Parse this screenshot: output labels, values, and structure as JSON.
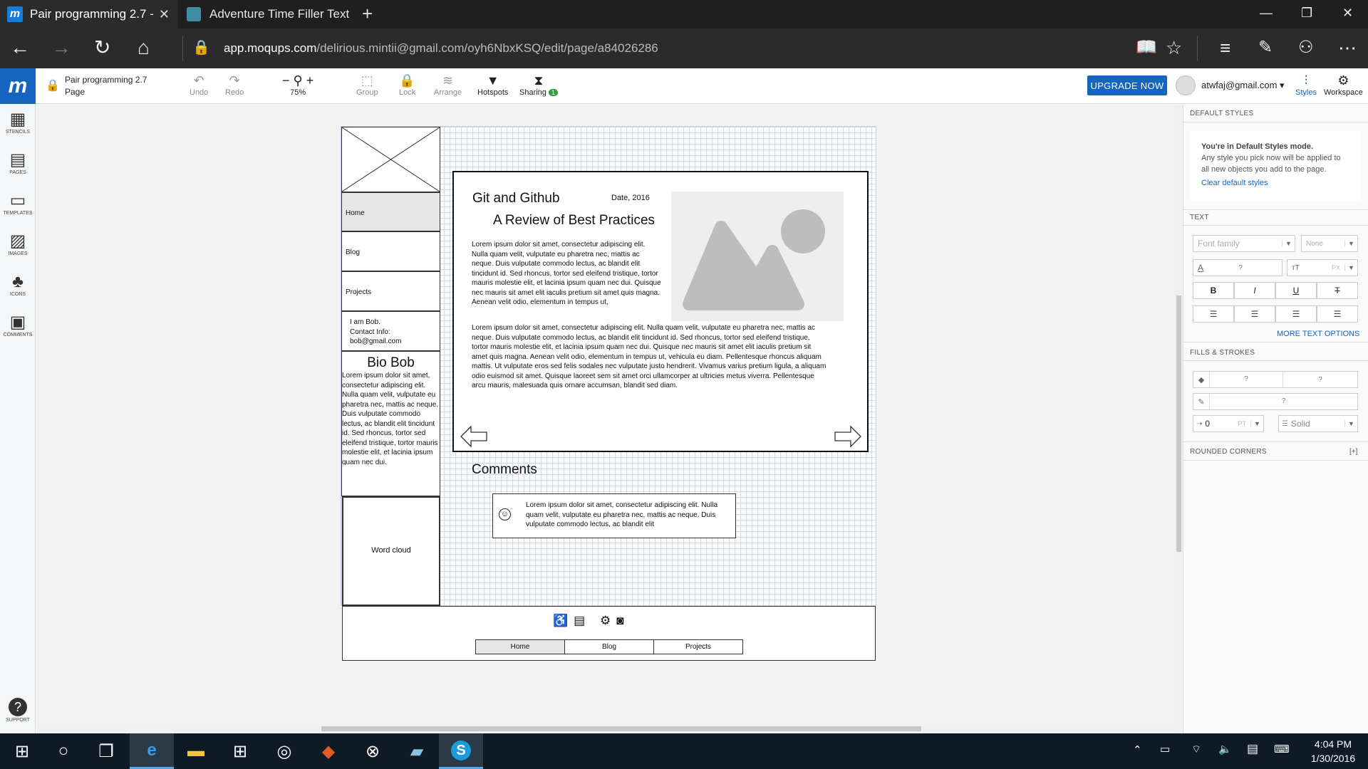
{
  "browser": {
    "tabs": [
      {
        "label": "Pair programming 2.7 -",
        "active": true
      },
      {
        "label": "Adventure Time Filler Text",
        "active": false
      }
    ],
    "url_domain": "app.moqups.com",
    "url_path": "/delirious.mintii@gmail.com/oyh6NbxKSQ/edit/page/a84026286"
  },
  "app": {
    "project": "Pair programming 2.7",
    "page_label": "Page",
    "toolbar": {
      "undo": "Undo",
      "redo": "Redo",
      "zoom": "75%",
      "group": "Group",
      "lock": "Lock",
      "arrange": "Arrange",
      "hotspots": "Hotspots",
      "sharing": "Sharing",
      "sharing_count": "1",
      "upgrade": "UPGRADE NOW",
      "user": "atwfaj@gmail.com",
      "styles": "Styles",
      "workspace": "Workspace"
    },
    "rail": [
      {
        "label": "STENCILS",
        "icon": "stencils-icon"
      },
      {
        "label": "PAGES",
        "icon": "pages-icon"
      },
      {
        "label": "TEMPLATES",
        "icon": "templates-icon"
      },
      {
        "label": "IMAGES",
        "icon": "images-icon"
      },
      {
        "label": "ICONS",
        "icon": "club-icon"
      },
      {
        "label": "COMMENTS",
        "icon": "comments-icon"
      },
      {
        "label": "SUPPORT",
        "icon": "help-icon"
      }
    ]
  },
  "mockup": {
    "nav": [
      "Home",
      "Blog",
      "Projects"
    ],
    "contact": [
      "I am Bob.",
      "Contact Info:",
      "bob@gmail.com"
    ],
    "bio_title": "Bio Bob",
    "bio_text": "Lorem ipsum dolor sit amet, consectetur adipiscing elit. Nulla quam velit, vulputate eu pharetra nec, mattis ac neque. Duis vulputate commodo lectus, ac blandit elit tincidunt id. Sed rhoncus, tortor sed eleifend tristique, tortor mauris molestie elit, et lacinia ipsum quam nec dui.",
    "word_cloud": "Word cloud",
    "post_title": "Git and Github",
    "post_date": "Date, 2016",
    "post_subtitle": "A Review of Best Practices",
    "post_para1": "Lorem ipsum dolor sit amet, consectetur adipiscing elit. Nulla quam velit, vulputate eu pharetra nec, mattis ac neque. Duis vulputate commodo lectus, ac blandit elit tincidunt id. Sed rhoncus, tortor sed eleifend tristique, tortor mauris molestie elit, et lacinia ipsum quam nec dui. Quisque nec mauris sit amet elit iaculis pretium sit amet quis magna. Aenean velit odio, elementum in tempus ut,",
    "post_para2": "Lorem ipsum dolor sit amet, consectetur adipiscing elit. Nulla quam velit, vulputate eu pharetra nec, mattis ac neque. Duis vulputate commodo lectus, ac blandit elit tincidunt id. Sed rhoncus, tortor sed eleifend tristique, tortor mauris molestie elit, et lacinia ipsum quam nec dui. Quisque nec mauris sit amet elit iaculis pretium sit amet quis magna. Aenean velit odio, elementum in tempus ut, vehicula eu diam. Pellentesque rhoncus aliquam mattis. Ut vulputate eros sed felis sodales nec vulputate justo hendrerit. Vivamus varius pretium ligula, a aliquam odio euismod sit amet. Quisque laoreet sem sit amet orci ullamcorper at ultricies metus viverra. Pellentesque arcu mauris, malesuada quis ornare accumsan, blandit sed diam.",
    "comments_title": "Comments",
    "comment_text": "Lorem ipsum dolor sit amet, consectetur adipiscing elit. Nulla quam velit, vulputate eu pharetra nec, mattis ac neque. Duis vulputate commodo lectus, ac blandit elit",
    "footer_nav": [
      "Home",
      "Blog",
      "Projects"
    ]
  },
  "panel": {
    "default_styles": "DEFAULT STYLES",
    "mode_title": "You're in Default Styles mode.",
    "mode_desc": "Any style you pick now will be applied to all new objects you add to the page.",
    "clear": "Clear default styles",
    "text": "TEXT",
    "font_family": "Font family",
    "none": "None",
    "q": "?",
    "px": "PX",
    "more_text": "MORE TEXT OPTIONS",
    "fills": "FILLS & STROKES",
    "stroke_width": "0",
    "pt": "PT",
    "solid": "Solid",
    "rounded": "ROUNDED CORNERS",
    "rounded_add": "[+]"
  },
  "system": {
    "time": "4:04 PM",
    "date": "1/30/2016"
  }
}
